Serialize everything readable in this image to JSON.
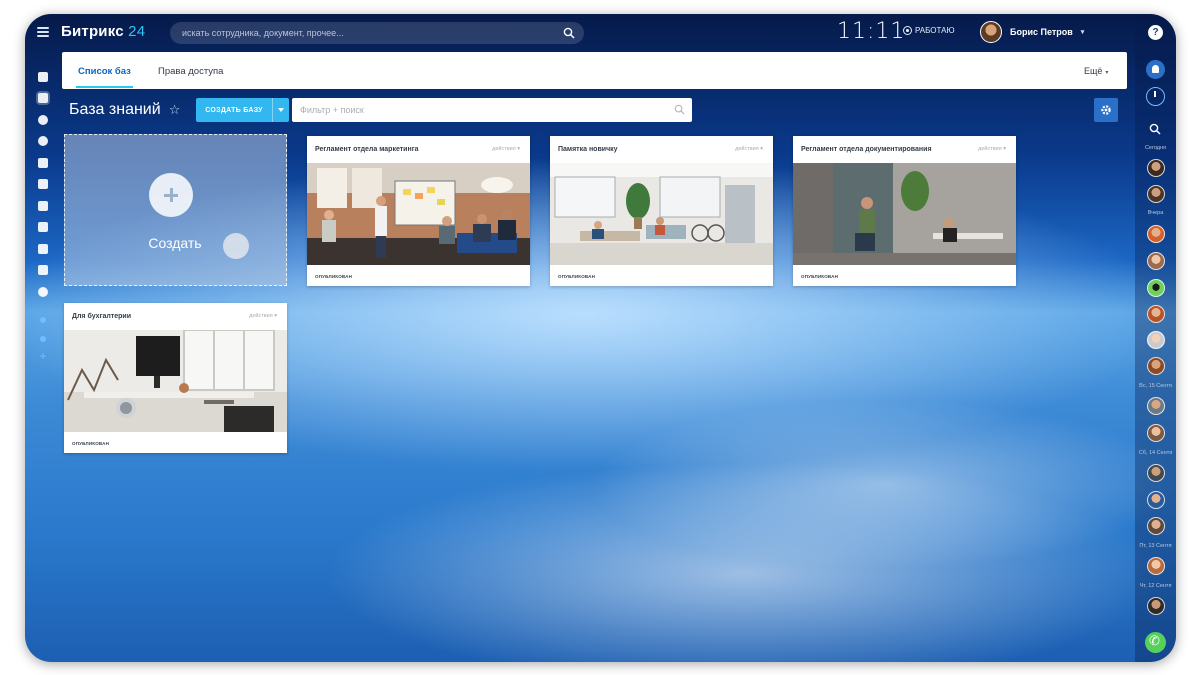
{
  "header": {
    "logo_name": "Битрикс",
    "logo_number": "24",
    "search_placeholder": "искать сотрудника, документ, прочее...",
    "clock": "11:11",
    "work_status": "РАБОТАЮ",
    "user_name": "Борис Петров"
  },
  "tabs": [
    {
      "label": "Список баз",
      "active": true
    },
    {
      "label": "Права доступа",
      "active": false
    }
  ],
  "more_label": "Ещё",
  "page": {
    "title": "База знаний",
    "create_button": "СОЗДАТЬ БАЗУ",
    "filter_placeholder": "Фильтр + поиск"
  },
  "create_card": {
    "label": "Создать"
  },
  "cards": [
    {
      "title": "Регламент отдела маркетинга",
      "actions": "действия",
      "status": "ОПУБЛИКОВАН"
    },
    {
      "title": "Памятка новичку",
      "actions": "действия",
      "status": "ОПУБЛИКОВАН"
    },
    {
      "title": "Регламент отдела документирования",
      "actions": "действия",
      "status": "ОПУБЛИКОВАН"
    },
    {
      "title": "Для бухгалтерии",
      "actions": "действия",
      "status": "ОПУБЛИКОВАН"
    }
  ],
  "right_rail": {
    "help": "?",
    "groups": [
      "Сегодня",
      "Вчера",
      "Вс, 15 Сентя",
      "Сб, 14 Сентя",
      "Пт, 13 Сентя",
      "Чт, 12 Сентя"
    ]
  },
  "colors": {
    "accent": "#2fc6f6",
    "create_button": "#33b7f0",
    "active_tab": "#0b66c3",
    "call_button": "#55d058"
  },
  "icons": {
    "menu": "burger-menu-icon",
    "search": "search-icon",
    "favorite": "star-icon",
    "settings": "gear-icon",
    "notifications": "bell-icon",
    "call": "phone-icon"
  }
}
